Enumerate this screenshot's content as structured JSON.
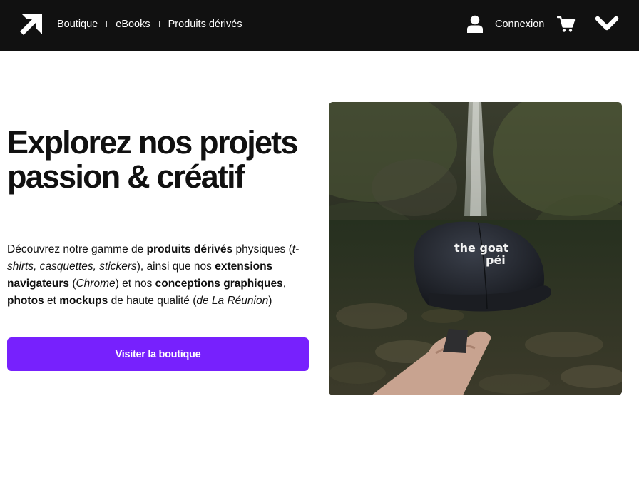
{
  "header": {
    "logo_icon": "arrow-up-right-icon",
    "nav": [
      {
        "label": "Boutique"
      },
      {
        "label": "eBooks"
      },
      {
        "label": "Produits dérivés"
      }
    ],
    "login_label": "Connexion",
    "user_icon": "user-icon",
    "cart_icon": "cart-icon",
    "menu_icon": "chevron-down-icon"
  },
  "hero": {
    "title": "Explorez nos projets passion & créatif",
    "description": [
      {
        "text": "Découvrez notre gamme de ",
        "style": "normal"
      },
      {
        "text": "produits dérivés",
        "style": "bold"
      },
      {
        "text": " physiques (",
        "style": "normal"
      },
      {
        "text": "t-shirts, casquettes, stickers",
        "style": "italic"
      },
      {
        "text": "), ainsi que nos ",
        "style": "normal"
      },
      {
        "text": "extensions navigateurs",
        "style": "bold"
      },
      {
        "text": " (",
        "style": "normal"
      },
      {
        "text": "Chrome",
        "style": "italic"
      },
      {
        "text": ") et nos ",
        "style": "normal"
      },
      {
        "text": "conceptions graphiques",
        "style": "bold"
      },
      {
        "text": ", ",
        "style": "normal"
      },
      {
        "text": "photos",
        "style": "bold"
      },
      {
        "text": " et ",
        "style": "normal"
      },
      {
        "text": "mockups",
        "style": "bold"
      },
      {
        "text": " de haute qualité (",
        "style": "normal"
      },
      {
        "text": "de La Réunion",
        "style": "italic"
      },
      {
        "text": ")",
        "style": "normal"
      }
    ],
    "cta_label": "Visiter la boutique",
    "image": {
      "cap_text_line1": "the goat",
      "cap_text_line2": "péi"
    }
  },
  "colors": {
    "header_bg": "#111111",
    "accent": "#7721fd",
    "text": "#111111"
  }
}
